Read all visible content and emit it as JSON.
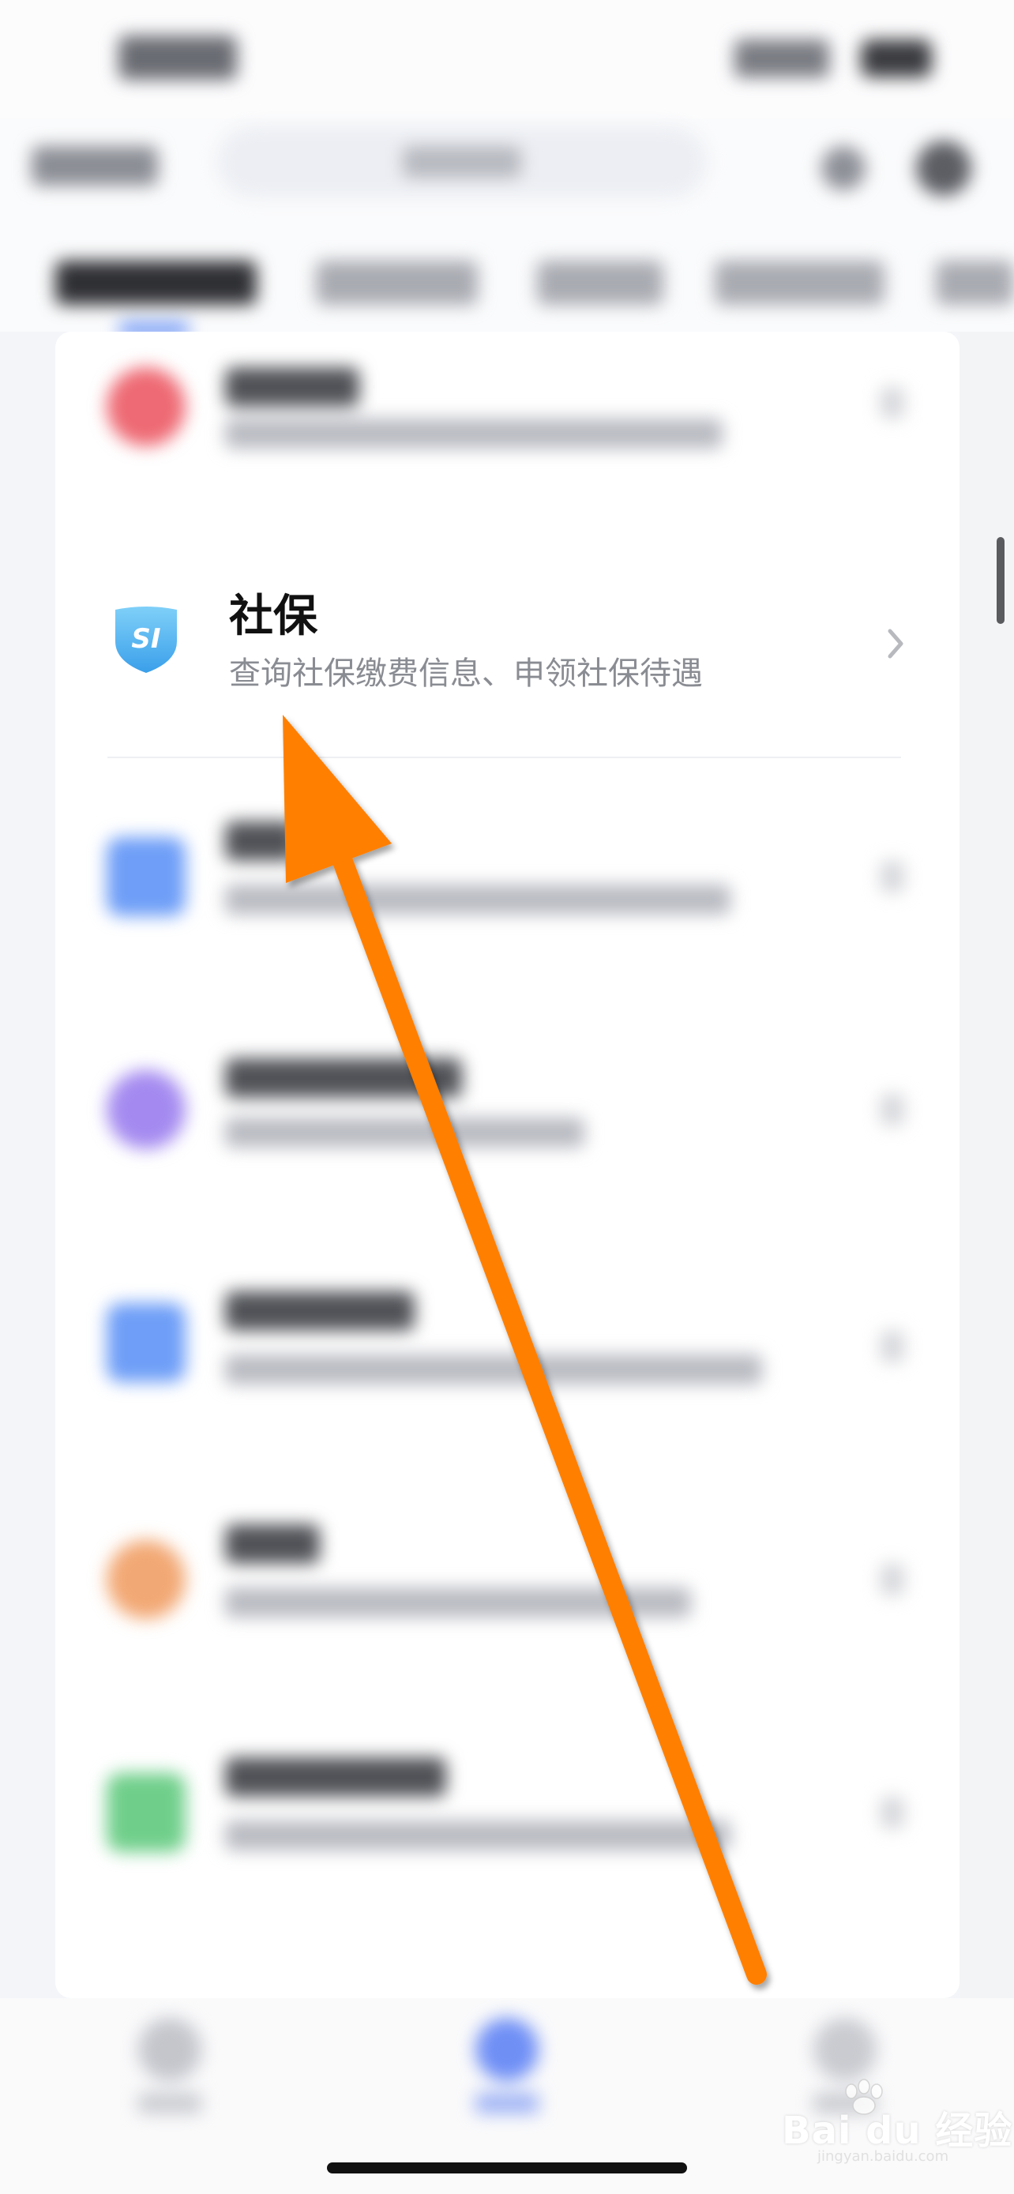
{
  "focus_item": {
    "title": "社保",
    "subtitle": "查询社保缴费信息、申领社保待遇",
    "icon_text": "SI",
    "icon": "social-insurance-shield-icon"
  },
  "colors": {
    "icon_shield_light": "#7fd0f8",
    "icon_shield_dark": "#3a9fea",
    "tab_accent": "#4b7cf5",
    "annotation_arrow": "#ff7f00"
  },
  "annotation": {
    "type": "arrow",
    "color": "#ff7f00",
    "points_to": "social-insurance-item"
  },
  "watermark": {
    "brand": "Bai du 经验",
    "url": "jingyan.baidu.com"
  }
}
